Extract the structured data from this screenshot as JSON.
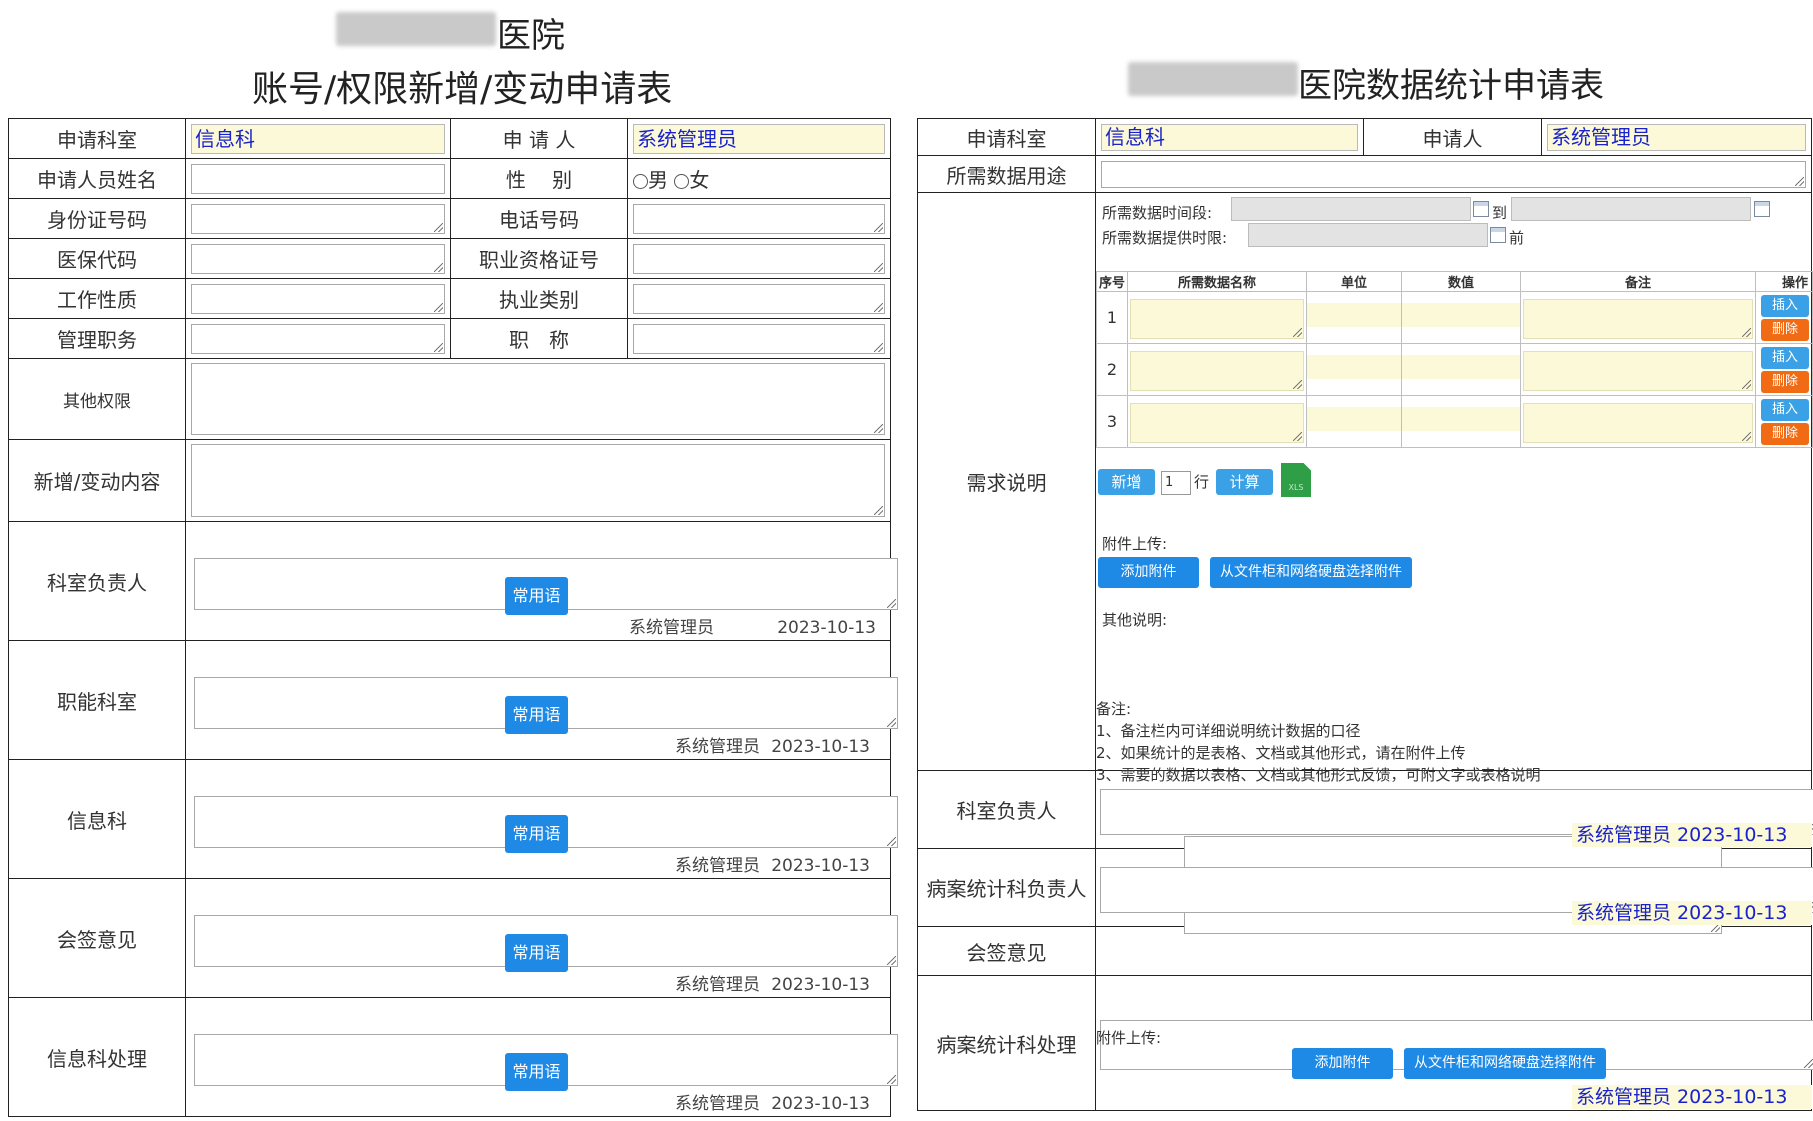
{
  "left": {
    "hospital_suffix": "医院",
    "title": "账号/权限新增/变动申请表",
    "dept_label": "申请科室",
    "dept_value": "信息科",
    "applicant_label": "申 请 人",
    "applicant_value": "系统管理员",
    "name_label": "申请人员姓名",
    "gender_label": "性　 别",
    "gender_male": "男",
    "gender_female": "女",
    "id_label": "身份证号码",
    "phone_label": "电话号码",
    "insurance_label": "医保代码",
    "qualification_label": "职业资格证号",
    "work_nature_label": "工作性质",
    "practice_label": "执业类别",
    "manage_label": "管理职务",
    "title_label": "职　称",
    "other_perm_label": "其他权限",
    "change_label": "新增/变动内容",
    "approvals": [
      {
        "label": "科室负责人",
        "button": "常用语",
        "signer": "系统管理员",
        "date": "2023-10-13"
      },
      {
        "label": "职能科室",
        "button": "常用语",
        "signer": "系统管理员",
        "date": "2023-10-13"
      },
      {
        "label": "信息科",
        "button": "常用语",
        "signer": "系统管理员",
        "date": "2023-10-13"
      },
      {
        "label": "会签意见",
        "button": "常用语",
        "signer": "系统管理员",
        "date": "2023-10-13"
      },
      {
        "label": "信息科处理",
        "button": "常用语",
        "signer": "系统管理员",
        "date": "2023-10-13"
      }
    ]
  },
  "right": {
    "title_suffix": "医院数据统计申请表",
    "dept_label": "申请科室",
    "dept_value": "信息科",
    "applicant_label": "申请人",
    "applicant_value": "系统管理员",
    "purpose_label": "所需数据用途",
    "req_label": "需求说明",
    "period_label": "所需数据时间段:",
    "period_to": "到",
    "deadline_label": "所需数据提供时限:",
    "deadline_suffix": "前",
    "table_headers": [
      "序号",
      "所需数据名称",
      "单位",
      "数值",
      "备注",
      "操作"
    ],
    "rows": [
      "1",
      "2",
      "3"
    ],
    "insert_label": "插入",
    "delete_label": "删除",
    "add_label": "新增",
    "row_count": "1",
    "row_unit": "行",
    "calc_label": "计算",
    "xls_label": "XLS",
    "attach_label": "附件上传:",
    "add_attach": "添加附件",
    "select_attach": "从文件柜和网络硬盘选择附件",
    "other_label": "其他说明:",
    "note_title": "备注:",
    "notes": [
      "1、备注栏内可详细说明统计数据的口径",
      "2、如果统计的是表格、文档或其他形式，请在附件上传",
      "3、需要的数据以表格、文档或其他形式反馈，可附文字或表格说明"
    ],
    "dept_head_label": "科室负责人",
    "dept_head_sig": "系统管理员 2023-10-13",
    "stat_head_label": "病案统计科负责人",
    "stat_head_sig": "系统管理员 2023-10-13",
    "countersign_label": "会签意见",
    "stat_process_label": "病案统计科处理",
    "stat_attach_label": "附件上传:",
    "stat_process_sig": "系统管理员 2023-10-13"
  }
}
